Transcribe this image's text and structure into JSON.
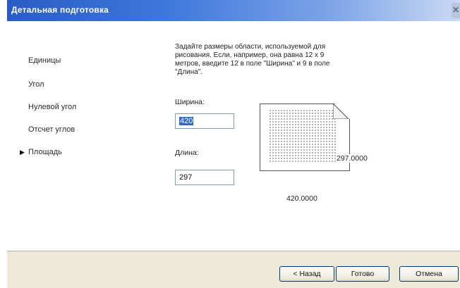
{
  "window": {
    "title": "Детальная подготовка",
    "close_glyph": "✕"
  },
  "nav": {
    "current_marker": "▶",
    "items": [
      {
        "label": "Единицы"
      },
      {
        "label": "Угол"
      },
      {
        "label": "Нулевой угол"
      },
      {
        "label": "Отсчет углов"
      },
      {
        "label": "Площадь",
        "current": true
      }
    ]
  },
  "content": {
    "description_lines": [
      "Задайте размеры области, используемой для",
      "рисования. Если, например, она равна 12 x 9",
      "метров, введите 12 в поле \"Ширина\" и 9 в поле",
      "\"Длина\"."
    ],
    "width_label": "Ширина:",
    "width_value": "420",
    "length_label": "Длина:",
    "length_value": "297",
    "preview_height": "297.0000",
    "preview_width": "420.0000"
  },
  "buttons": {
    "back": "< Назад",
    "finish": "Готово",
    "cancel": "Отмена"
  },
  "colors": {
    "titlebar_start": "#2a5cc4",
    "titlebar_end": "#c9d9f4",
    "selection": "#316ac5"
  }
}
